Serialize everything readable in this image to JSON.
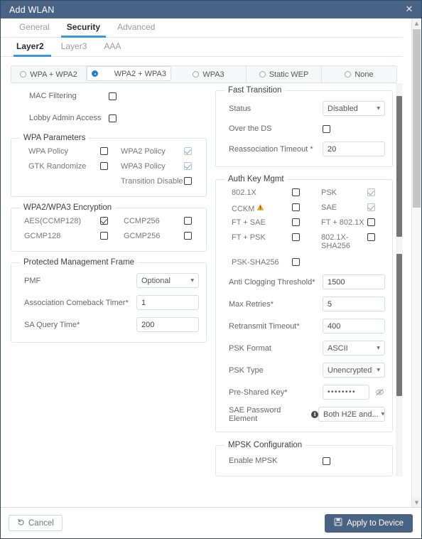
{
  "window": {
    "title": "Add WLAN",
    "close_icon": "close-icon"
  },
  "tabs_main": [
    {
      "label": "General",
      "active": false
    },
    {
      "label": "Security",
      "active": true
    },
    {
      "label": "Advanced",
      "active": false
    }
  ],
  "tabs_sub": [
    {
      "label": "Layer2",
      "active": true
    },
    {
      "label": "Layer3",
      "active": false
    },
    {
      "label": "AAA",
      "active": false
    }
  ],
  "security_modes": [
    {
      "label": "WPA + WPA2",
      "selected": false
    },
    {
      "label": "WPA2 + WPA3",
      "selected": true
    },
    {
      "label": "WPA3",
      "selected": false
    },
    {
      "label": "Static WEP",
      "selected": false
    },
    {
      "label": "None",
      "selected": false
    }
  ],
  "toggles": {
    "mac_filtering_label": "MAC Filtering",
    "mac_filtering_checked": false,
    "lobby_admin_label": "Lobby Admin Access",
    "lobby_admin_checked": false
  },
  "wpa_parameters": {
    "legend": "WPA Parameters",
    "left": [
      {
        "label": "WPA Policy",
        "checked": false,
        "disabled": false
      },
      {
        "label": "GTK Randomize",
        "checked": false,
        "disabled": false
      }
    ],
    "right": [
      {
        "label": "WPA2 Policy",
        "checked": true,
        "disabled": true
      },
      {
        "label": "WPA3 Policy",
        "checked": true,
        "disabled": true
      },
      {
        "label": "Transition Disable",
        "checked": false,
        "disabled": false
      }
    ]
  },
  "encryption": {
    "legend": "WPA2/WPA3 Encryption",
    "left": [
      {
        "label": "AES(CCMP128)",
        "checked": true,
        "disabled": false
      },
      {
        "label": "GCMP128",
        "checked": false,
        "disabled": false
      }
    ],
    "right": [
      {
        "label": "CCMP256",
        "checked": false,
        "disabled": false
      },
      {
        "label": "GCMP256",
        "checked": false,
        "disabled": false
      }
    ]
  },
  "pmf": {
    "legend": "Protected Management Frame",
    "rows": [
      {
        "label": "PMF",
        "type": "select",
        "value": "Optional"
      },
      {
        "label": "Association Comeback Timer*",
        "type": "input",
        "value": "1"
      },
      {
        "label": "SA Query Time*",
        "type": "input",
        "value": "200"
      }
    ]
  },
  "fast_transition": {
    "legend": "Fast Transition",
    "status_label": "Status",
    "status_value": "Disabled",
    "over_ds_label": "Over the DS",
    "over_ds_checked": false,
    "reassoc_label": "Reassociation Timeout *",
    "reassoc_value": "20"
  },
  "auth_key_mgmt": {
    "legend": "Auth Key Mgmt",
    "left": [
      {
        "label": "802.1X",
        "checked": false,
        "warn": false
      },
      {
        "label": "CCKM",
        "checked": false,
        "warn": true
      },
      {
        "label": "FT + SAE",
        "checked": false,
        "warn": false
      },
      {
        "label": "FT + PSK",
        "checked": false,
        "warn": false
      }
    ],
    "right": [
      {
        "label": "PSK",
        "checked": true,
        "warn": false
      },
      {
        "label": "SAE",
        "checked": true,
        "warn": false
      },
      {
        "label": "FT + 802.1X",
        "checked": false,
        "warn": false
      },
      {
        "label": "802.1X-SHA256",
        "checked": false,
        "warn": false
      }
    ],
    "psk_sha256_label": "PSK-SHA256",
    "psk_sha256_checked": false,
    "fields": [
      {
        "label": "Anti Clogging Threshold*",
        "type": "input",
        "value": "1500"
      },
      {
        "label": "Max Retries*",
        "type": "input",
        "value": "5"
      },
      {
        "label": "Retransmit Timeout*",
        "type": "input",
        "value": "400"
      },
      {
        "label": "PSK Format",
        "type": "select",
        "value": "ASCII"
      },
      {
        "label": "PSK Type",
        "type": "select",
        "value": "Unencrypted"
      }
    ],
    "psk_label": "Pre-Shared Key*",
    "psk_value": "••••••••",
    "psk_reveal_icon": "eye-slash-icon",
    "sae_label": "SAE Password Element",
    "sae_info_icon": "info-icon",
    "sae_value": "Both H2E and..."
  },
  "mpsk": {
    "legend": "MPSK Configuration",
    "enable_label": "Enable MPSK",
    "enable_checked": false
  },
  "footer": {
    "cancel_label": "Cancel",
    "cancel_icon": "undo-icon",
    "apply_label": "Apply to Device",
    "apply_icon": "save-icon"
  },
  "colors": {
    "titlebar": "#4a6384",
    "accent": "#3a9ad9",
    "radio_selected": "#1f7fd0",
    "warning": "#f0a318",
    "apply_button": "#4a6384"
  }
}
